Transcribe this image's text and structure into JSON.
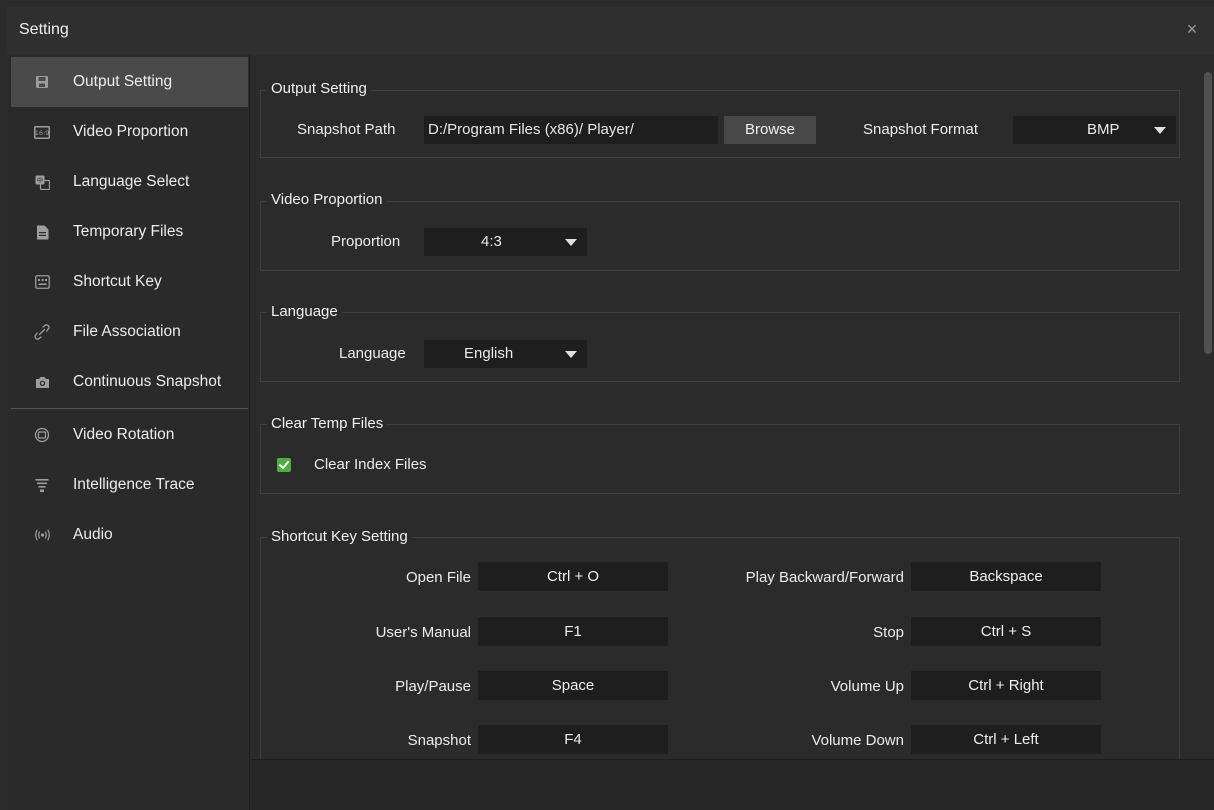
{
  "window": {
    "title": "Setting",
    "close_glyph": "×"
  },
  "sidebar": {
    "items": [
      {
        "label": "Output Setting",
        "icon": "save-icon"
      },
      {
        "label": "Video Proportion",
        "icon": "aspect-ratio-icon"
      },
      {
        "label": "Language Select",
        "icon": "language-icon"
      },
      {
        "label": "Temporary Files",
        "icon": "file-icon"
      },
      {
        "label": "Shortcut Key",
        "icon": "keyboard-icon"
      },
      {
        "label": "File Association",
        "icon": "link-icon"
      },
      {
        "label": "Continuous Snapshot",
        "icon": "camera-icon"
      },
      {
        "label": "Video Rotation",
        "icon": "rotation-icon"
      },
      {
        "label": "Intelligence Trace",
        "icon": "trace-icon"
      },
      {
        "label": "Audio",
        "icon": "audio-icon"
      }
    ],
    "active_index": 0
  },
  "output_setting": {
    "title": "Output Setting",
    "snapshot_path_label": "Snapshot Path",
    "snapshot_path_value": "D:/Program Files (x86)/ Player/",
    "browse_label": "Browse",
    "snapshot_format_label": "Snapshot Format",
    "snapshot_format_value": "BMP"
  },
  "video_proportion": {
    "title": "Video Proportion",
    "proportion_label": "Proportion",
    "proportion_value": "4:3"
  },
  "language": {
    "title": "Language",
    "language_label": "Language",
    "language_value": "English"
  },
  "clear_temp": {
    "title": "Clear Temp Files",
    "clear_index_label": "Clear Index Files",
    "clear_index_checked": true
  },
  "shortcuts": {
    "title": "Shortcut Key Setting",
    "left": [
      {
        "label": "Open File",
        "key": "Ctrl + O"
      },
      {
        "label": "User's Manual",
        "key": "F1"
      },
      {
        "label": "Play/Pause",
        "key": "Space"
      },
      {
        "label": "Snapshot",
        "key": "F4"
      }
    ],
    "right": [
      {
        "label": "Play Backward/Forward",
        "key": "Backspace"
      },
      {
        "label": "Stop",
        "key": "Ctrl + S"
      },
      {
        "label": "Volume Up",
        "key": "Ctrl + Right"
      },
      {
        "label": "Volume Down",
        "key": "Ctrl + Left"
      }
    ]
  },
  "colors": {
    "background": "#2b2b2b",
    "active_nav": "#4a4a4a",
    "field": "#1e1e1e",
    "checkbox": "#4fae3f"
  }
}
